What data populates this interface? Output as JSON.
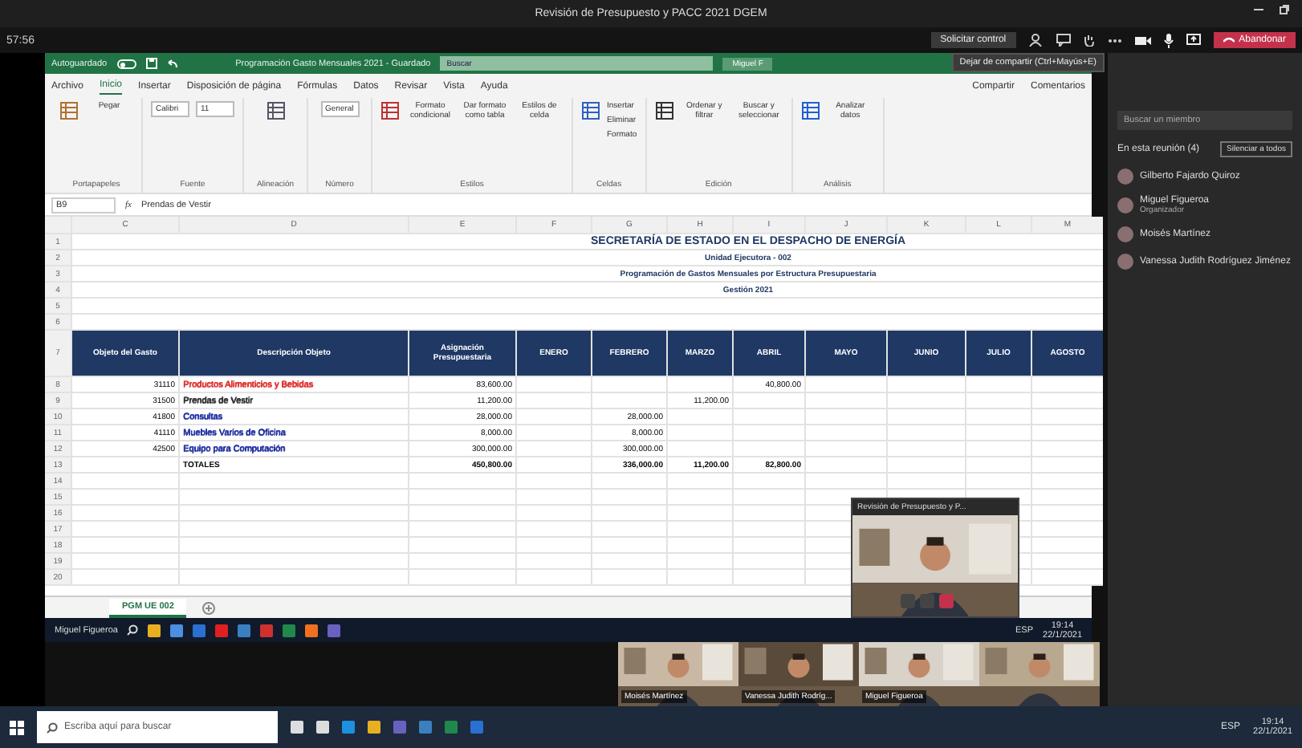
{
  "teams": {
    "title": "Revisión de Presupuesto y PACC 2021 DGEM",
    "timer": "57:56",
    "control_button": "Solicitar control",
    "leave_button": "Abandonar",
    "tooltip": "Dejar de compartir (Ctrl+Mayús+E)"
  },
  "excel": {
    "autosave_label": "Autoguardado",
    "autosave_on": false,
    "file_title": "Programación Gasto Mensuales 2021 - Guardado",
    "search_placeholder": "Buscar",
    "user": "Miguel F",
    "menu_tabs": [
      {
        "label": "Archivo",
        "selected": false
      },
      {
        "label": "Inicio",
        "selected": true
      },
      {
        "label": "Insertar",
        "selected": false
      },
      {
        "label": "Disposición de página",
        "selected": false
      },
      {
        "label": "Fórmulas",
        "selected": false
      },
      {
        "label": "Datos",
        "selected": false
      },
      {
        "label": "Revisar",
        "selected": false
      },
      {
        "label": "Vista",
        "selected": false
      },
      {
        "label": "Ayuda",
        "selected": false
      }
    ],
    "share": "Compartir",
    "comments": "Comentarios",
    "ribbon_groups": [
      {
        "label": "Portapapeles",
        "items": [
          {
            "kind": "button",
            "text": "Pegar"
          }
        ]
      },
      {
        "label": "Fuente",
        "items": [
          {
            "kind": "field",
            "text": "Calibri"
          },
          {
            "kind": "field",
            "text": "11"
          }
        ]
      },
      {
        "label": "Alineación"
      },
      {
        "label": "Número",
        "items": [
          {
            "kind": "field",
            "text": "General"
          }
        ]
      },
      {
        "label": "Estilos",
        "items": [
          {
            "kind": "button",
            "text": "Formato condicional"
          },
          {
            "kind": "button",
            "text": "Dar formato como tabla"
          },
          {
            "kind": "button",
            "text": "Estilos de celda"
          }
        ]
      },
      {
        "label": "Celdas",
        "items": [
          {
            "kind": "line",
            "text": "Insertar"
          },
          {
            "kind": "line",
            "text": "Eliminar"
          },
          {
            "kind": "line",
            "text": "Formato"
          }
        ]
      },
      {
        "label": "Edición",
        "items": [
          {
            "kind": "button",
            "text": "Ordenar y filtrar"
          },
          {
            "kind": "button",
            "text": "Buscar y seleccionar"
          }
        ]
      },
      {
        "label": "Análisis",
        "items": [
          {
            "kind": "button",
            "text": "Analizar datos"
          }
        ]
      }
    ],
    "name_box": "B9",
    "function_label": "fx",
    "formula": "Prendas de Vestir",
    "column_letters": [
      "C",
      "D",
      "E",
      "F",
      "G",
      "H",
      "I",
      "J",
      "K",
      "L",
      "M"
    ],
    "title_row_numbers": [
      "1",
      "2",
      "3",
      "4",
      "5",
      "6"
    ],
    "report_titles": [
      "SECRETARÍA DE ESTADO EN EL DESPACHO DE ENERGÍA",
      "Unidad Ejecutora - 002",
      "Programación de Gastos Mensuales por Estructura Presupuestaria",
      "Gestión 2021"
    ],
    "table": {
      "header_row_number": "7",
      "columns": [
        "Objeto del Gasto",
        "Descripción Objeto",
        "Asignación Presupuestaria",
        "ENERO",
        "FEBRERO",
        "MARZO",
        "ABRIL",
        "MAYO",
        "JUNIO",
        "JULIO",
        "AGOSTO"
      ],
      "rows": [
        {
          "row_number": "8",
          "code": "31110",
          "description": "Productos Alimenticios y Bebidas",
          "color": "#e03030",
          "assignment": "83,600.00",
          "months": [
            {
              "kind": "empty"
            },
            {
              "kind": "empty"
            },
            {
              "kind": "empty"
            },
            {
              "kind": "value",
              "value": "40,800.00"
            },
            {
              "kind": "empty"
            },
            {
              "kind": "empty"
            },
            {
              "kind": "empty"
            },
            {
              "kind": "empty"
            }
          ]
        },
        {
          "row_number": "9",
          "code": "31500",
          "description": "Prendas de Vestir",
          "color": "#303030",
          "assignment": "11,200.00",
          "months": [
            {
              "kind": "empty"
            },
            {
              "kind": "empty"
            },
            {
              "kind": "value",
              "value": "11,200.00"
            },
            {
              "kind": "empty"
            },
            {
              "kind": "empty"
            },
            {
              "kind": "empty"
            },
            {
              "kind": "empty"
            },
            {
              "kind": "empty"
            }
          ]
        },
        {
          "row_number": "10",
          "code": "41800",
          "description": "Consultas",
          "color": "#2030a0",
          "assignment": "28,000.00",
          "months": [
            {
              "kind": "empty"
            },
            {
              "kind": "value",
              "value": "28,000.00"
            },
            {
              "kind": "empty"
            },
            {
              "kind": "empty"
            },
            {
              "kind": "empty"
            },
            {
              "kind": "empty"
            },
            {
              "kind": "empty"
            },
            {
              "kind": "empty"
            }
          ]
        },
        {
          "row_number": "11",
          "code": "41110",
          "description": "Muebles Varios de Oficina",
          "color": "#2030a0",
          "assignment": "8,000.00",
          "months": [
            {
              "kind": "empty"
            },
            {
              "kind": "value",
              "value": "8,000.00"
            },
            {
              "kind": "empty"
            },
            {
              "kind": "empty"
            },
            {
              "kind": "empty"
            },
            {
              "kind": "empty"
            },
            {
              "kind": "empty"
            },
            {
              "kind": "empty"
            }
          ]
        },
        {
          "row_number": "12",
          "code": "42500",
          "description": "Equipo para Computación",
          "color": "#2030a0",
          "assignment": "300,000.00",
          "months": [
            {
              "kind": "empty"
            },
            {
              "kind": "value",
              "value": "300,000.00"
            },
            {
              "kind": "empty"
            },
            {
              "kind": "empty"
            },
            {
              "kind": "empty"
            },
            {
              "kind": "empty"
            },
            {
              "kind": "empty"
            },
            {
              "kind": "empty"
            }
          ]
        }
      ],
      "totals": {
        "row_number": "13",
        "label": "TOTALES",
        "assignment": "450,800.00",
        "months": [
          {
            "kind": "empty"
          },
          {
            "kind": "value",
            "value": "336,000.00"
          },
          {
            "kind": "value",
            "value": "11,200.00"
          },
          {
            "kind": "value",
            "value": "82,800.00"
          },
          {
            "kind": "empty"
          },
          {
            "kind": "empty"
          },
          {
            "kind": "empty"
          },
          {
            "kind": "empty"
          }
        ]
      }
    },
    "empty_row_numbers": [
      "14",
      "15",
      "16",
      "17",
      "18",
      "19",
      "20"
    ],
    "sheet_tabs": [
      {
        "label": "PGM UE 002",
        "selected": true
      }
    ]
  },
  "presenter": {
    "title": "Revisión de Presupuesto y P..."
  },
  "remote_taskbar": {
    "user": "Miguel Figueroa",
    "language": "ESP",
    "time": "19:14",
    "date": "22/1/2021"
  },
  "video_tiles": [
    {
      "kind": "picture",
      "name": "Moisés Martínez"
    },
    {
      "kind": "picture",
      "name": "Vanessa Judith Rodríg..."
    },
    {
      "kind": "picture",
      "name": "Miguel Figueroa"
    },
    {
      "kind": "picture"
    }
  ],
  "participants": {
    "search_placeholder": "Buscar un miembro",
    "section": "En esta reunión (4)",
    "mute_all": "Silenciar a todos",
    "people": [
      {
        "name": "Gilberto Fajardo Quiroz"
      },
      {
        "name": "Miguel Figueroa",
        "role": "Organizador"
      },
      {
        "name": "Moisés Martínez"
      },
      {
        "name": "Vanessa Judith Rodríguez Jiménez"
      }
    ]
  },
  "taskbar": {
    "search_placeholder": "Escriba aquí para buscar",
    "language": "ESP",
    "time": "19:14",
    "date": "22/1/2021"
  }
}
